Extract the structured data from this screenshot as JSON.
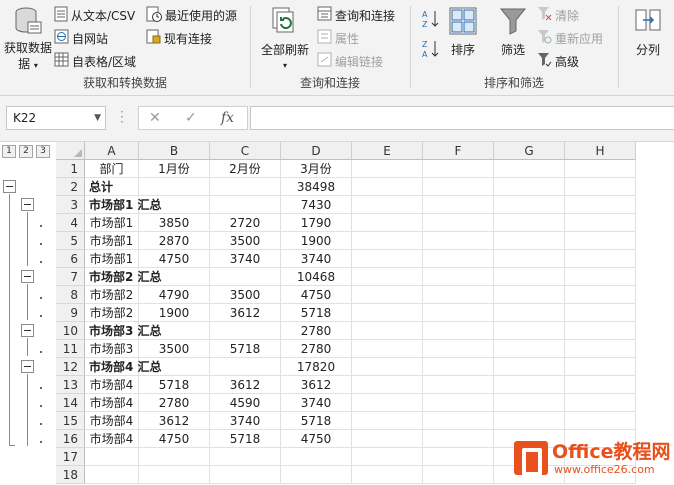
{
  "ribbon": {
    "get_data": "获取数据",
    "from_text_csv": "从文本/CSV",
    "recent_sources": "最近使用的源",
    "from_web": "自网站",
    "existing_connections": "现有连接",
    "from_table": "自表格/区域",
    "group_get_transform": "获取和转换数据",
    "refresh_all": "全部刷新",
    "queries_connections": "查询和连接",
    "properties": "属性",
    "edit_links": "编辑链接",
    "group_queries": "查询和连接",
    "sort": "排序",
    "filter": "筛选",
    "clear": "清除",
    "reapply": "重新应用",
    "advanced": "高级",
    "group_sort_filter": "排序和筛选",
    "split": "分列"
  },
  "formula_bar": {
    "name_box": "K22",
    "cancel_icon": "✕",
    "enter_icon": "✓",
    "fx": "fx",
    "formula": ""
  },
  "outline": {
    "levels": [
      "1",
      "2",
      "3"
    ]
  },
  "columns": [
    "A",
    "B",
    "C",
    "D",
    "E",
    "F",
    "G",
    "H"
  ],
  "rows": [
    {
      "n": "1",
      "a": "部门",
      "b": "1月份",
      "c": "2月份",
      "d": "3月份",
      "bold": false
    },
    {
      "n": "2",
      "a": "总计",
      "b": "",
      "c": "",
      "d": "38498",
      "bold": true
    },
    {
      "n": "3",
      "a": "市场部1 汇总",
      "b": "",
      "c": "",
      "d": "7430",
      "bold": true
    },
    {
      "n": "4",
      "a": "市场部1",
      "b": "3850",
      "c": "2720",
      "d": "1790",
      "bold": false
    },
    {
      "n": "5",
      "a": "市场部1",
      "b": "2870",
      "c": "3500",
      "d": "1900",
      "bold": false
    },
    {
      "n": "6",
      "a": "市场部1",
      "b": "4750",
      "c": "3740",
      "d": "3740",
      "bold": false
    },
    {
      "n": "7",
      "a": "市场部2 汇总",
      "b": "",
      "c": "",
      "d": "10468",
      "bold": true
    },
    {
      "n": "8",
      "a": "市场部2",
      "b": "4790",
      "c": "3500",
      "d": "4750",
      "bold": false
    },
    {
      "n": "9",
      "a": "市场部2",
      "b": "1900",
      "c": "3612",
      "d": "5718",
      "bold": false
    },
    {
      "n": "10",
      "a": "市场部3 汇总",
      "b": "",
      "c": "",
      "d": "2780",
      "bold": true
    },
    {
      "n": "11",
      "a": "市场部3",
      "b": "3500",
      "c": "5718",
      "d": "2780",
      "bold": false
    },
    {
      "n": "12",
      "a": "市场部4 汇总",
      "b": "",
      "c": "",
      "d": "17820",
      "bold": true
    },
    {
      "n": "13",
      "a": "市场部4",
      "b": "5718",
      "c": "3612",
      "d": "3612",
      "bold": false
    },
    {
      "n": "14",
      "a": "市场部4",
      "b": "2780",
      "c": "4590",
      "d": "3740",
      "bold": false
    },
    {
      "n": "15",
      "a": "市场部4",
      "b": "3612",
      "c": "3740",
      "d": "5718",
      "bold": false
    },
    {
      "n": "16",
      "a": "市场部4",
      "b": "4750",
      "c": "5718",
      "d": "4750",
      "bold": false
    },
    {
      "n": "17",
      "a": "",
      "b": "",
      "c": "",
      "d": "",
      "bold": false
    },
    {
      "n": "18",
      "a": "",
      "b": "",
      "c": "",
      "d": "",
      "bold": false
    }
  ],
  "watermark": {
    "title": "Office教程网",
    "url": "www.office26.com"
  },
  "colors": {
    "accent": "#e8501c",
    "ribbon_bg": "#f3f3f3",
    "header_bg": "#f0f0f0",
    "excel_green": "#217346"
  }
}
